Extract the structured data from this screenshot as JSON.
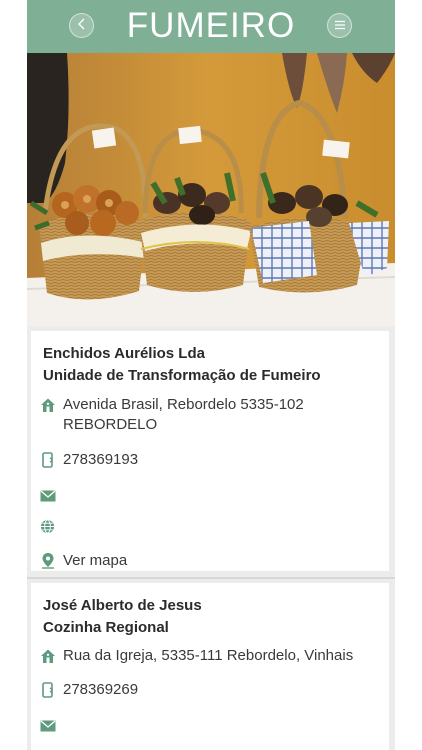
{
  "header": {
    "title": "FUMEIRO",
    "back_icon": "chevron-left-icon",
    "menu_icon": "menu-icon"
  },
  "colors": {
    "header_bg": "#7fb096",
    "icon_green": "#5e9b7c"
  },
  "listings": [
    {
      "name": "Enchidos Aurélios Lda",
      "subtitle": "Unidade de Transformação de Fumeiro",
      "address_line1": "Avenida Brasil, Rebordelo 5335-102",
      "address_line2": "REBORDELO",
      "phone": "278369193",
      "email_icon": "envelope-icon",
      "web_icon": "globe-icon",
      "map_label": "Ver mapa"
    },
    {
      "name": "José Alberto de Jesus",
      "subtitle": "Cozinha Regional",
      "address_line1": "Rua da Igreja, 5335-111 Rebordelo, Vinhais",
      "phone": "278369269",
      "email_icon": "envelope-icon"
    }
  ]
}
